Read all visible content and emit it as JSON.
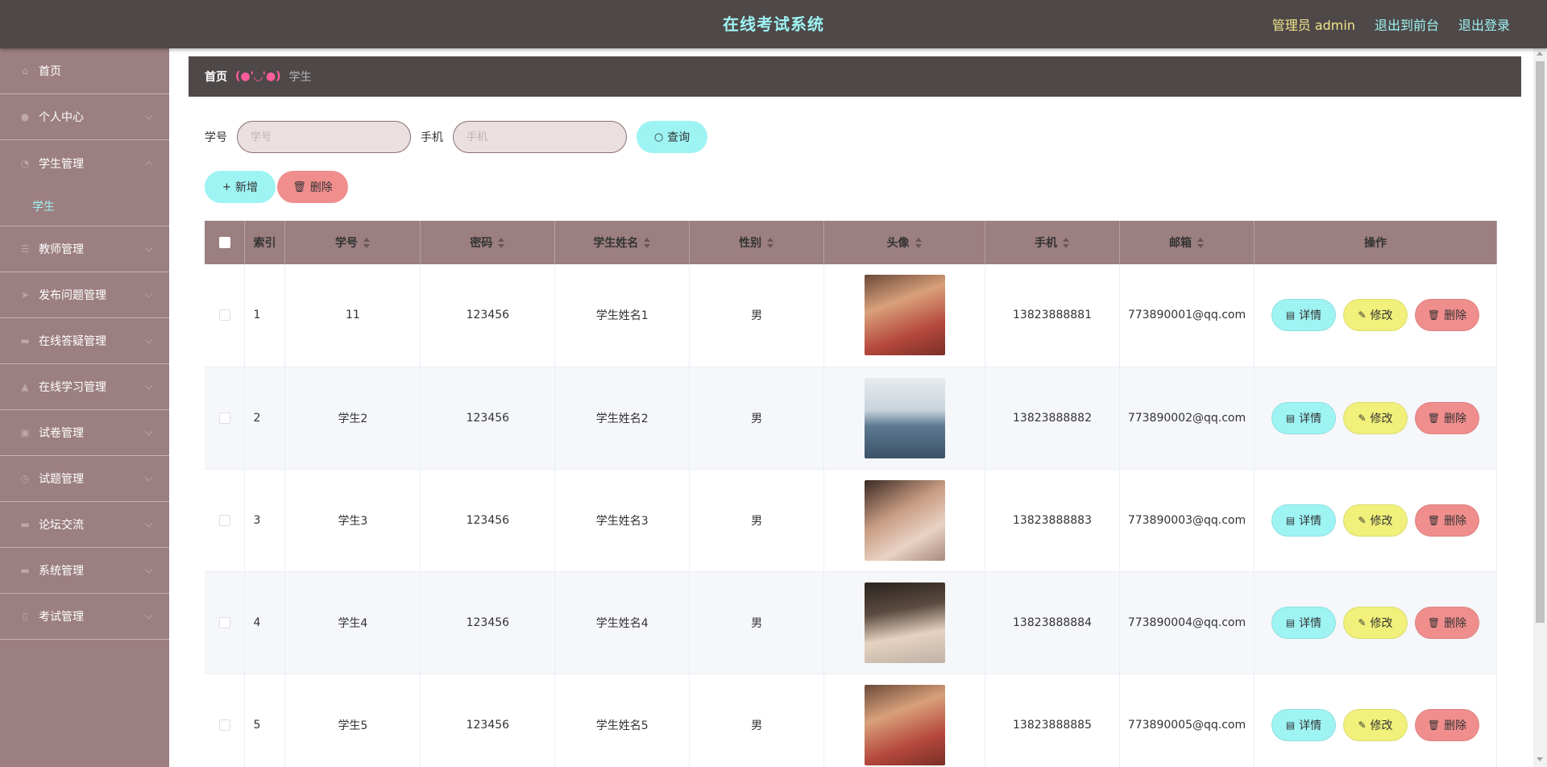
{
  "header": {
    "title": "在线考试系统",
    "admin_label": "管理员 admin",
    "to_front": "退出到前台",
    "logout": "退出登录"
  },
  "sidebar": {
    "items": [
      {
        "label": "首页",
        "icon": "home-icon"
      },
      {
        "label": "个人中心",
        "icon": "user-icon"
      },
      {
        "label": "学生管理",
        "icon": "student-icon",
        "sub": [
          "学生"
        ]
      },
      {
        "label": "教师管理",
        "icon": "list-icon"
      },
      {
        "label": "发布问题管理",
        "icon": "send-icon"
      },
      {
        "label": "在线答疑管理",
        "icon": "chat-icon"
      },
      {
        "label": "在线学习管理",
        "icon": "study-icon"
      },
      {
        "label": "试卷管理",
        "icon": "paper-icon"
      },
      {
        "label": "试题管理",
        "icon": "clock-icon"
      },
      {
        "label": "论坛交流",
        "icon": "forum-icon"
      },
      {
        "label": "系统管理",
        "icon": "system-icon"
      },
      {
        "label": "考试管理",
        "icon": "exam-icon"
      }
    ]
  },
  "breadcrumb": {
    "home": "首页",
    "separator": "(●'◡'●)",
    "current": "学生"
  },
  "filter": {
    "student_no_label": "学号",
    "student_no_placeholder": "学号",
    "phone_label": "手机",
    "phone_placeholder": "手机",
    "query_button": "查询"
  },
  "actions": {
    "add_button": "新增",
    "delete_button": "删除"
  },
  "table": {
    "columns": [
      "索引",
      "学号",
      "密码",
      "学生姓名",
      "性别",
      "头像",
      "手机",
      "邮箱",
      "操作"
    ],
    "rows": [
      {
        "index": "1",
        "student_no": "11",
        "password": "123456",
        "name": "学生姓名1",
        "gender": "男",
        "phone": "13823888881",
        "email": "773890001@qq.com"
      },
      {
        "index": "2",
        "student_no": "学生2",
        "password": "123456",
        "name": "学生姓名2",
        "gender": "男",
        "phone": "13823888882",
        "email": "773890002@qq.com"
      },
      {
        "index": "3",
        "student_no": "学生3",
        "password": "123456",
        "name": "学生姓名3",
        "gender": "男",
        "phone": "13823888883",
        "email": "773890003@qq.com"
      },
      {
        "index": "4",
        "student_no": "学生4",
        "password": "123456",
        "name": "学生姓名4",
        "gender": "男",
        "phone": "13823888884",
        "email": "773890004@qq.com"
      },
      {
        "index": "5",
        "student_no": "学生5",
        "password": "123456",
        "name": "学生姓名5",
        "gender": "男",
        "phone": "13823888885",
        "email": "773890005@qq.com"
      }
    ],
    "row_actions": {
      "detail": "详情",
      "edit": "修改",
      "delete": "删除"
    }
  },
  "colors": {
    "topbar": "#4f4848",
    "sidebar": "#9c7f81",
    "accent_cyan": "#9ef3f3",
    "accent_yellow": "#f0f07a",
    "accent_red": "#f08d8d"
  }
}
